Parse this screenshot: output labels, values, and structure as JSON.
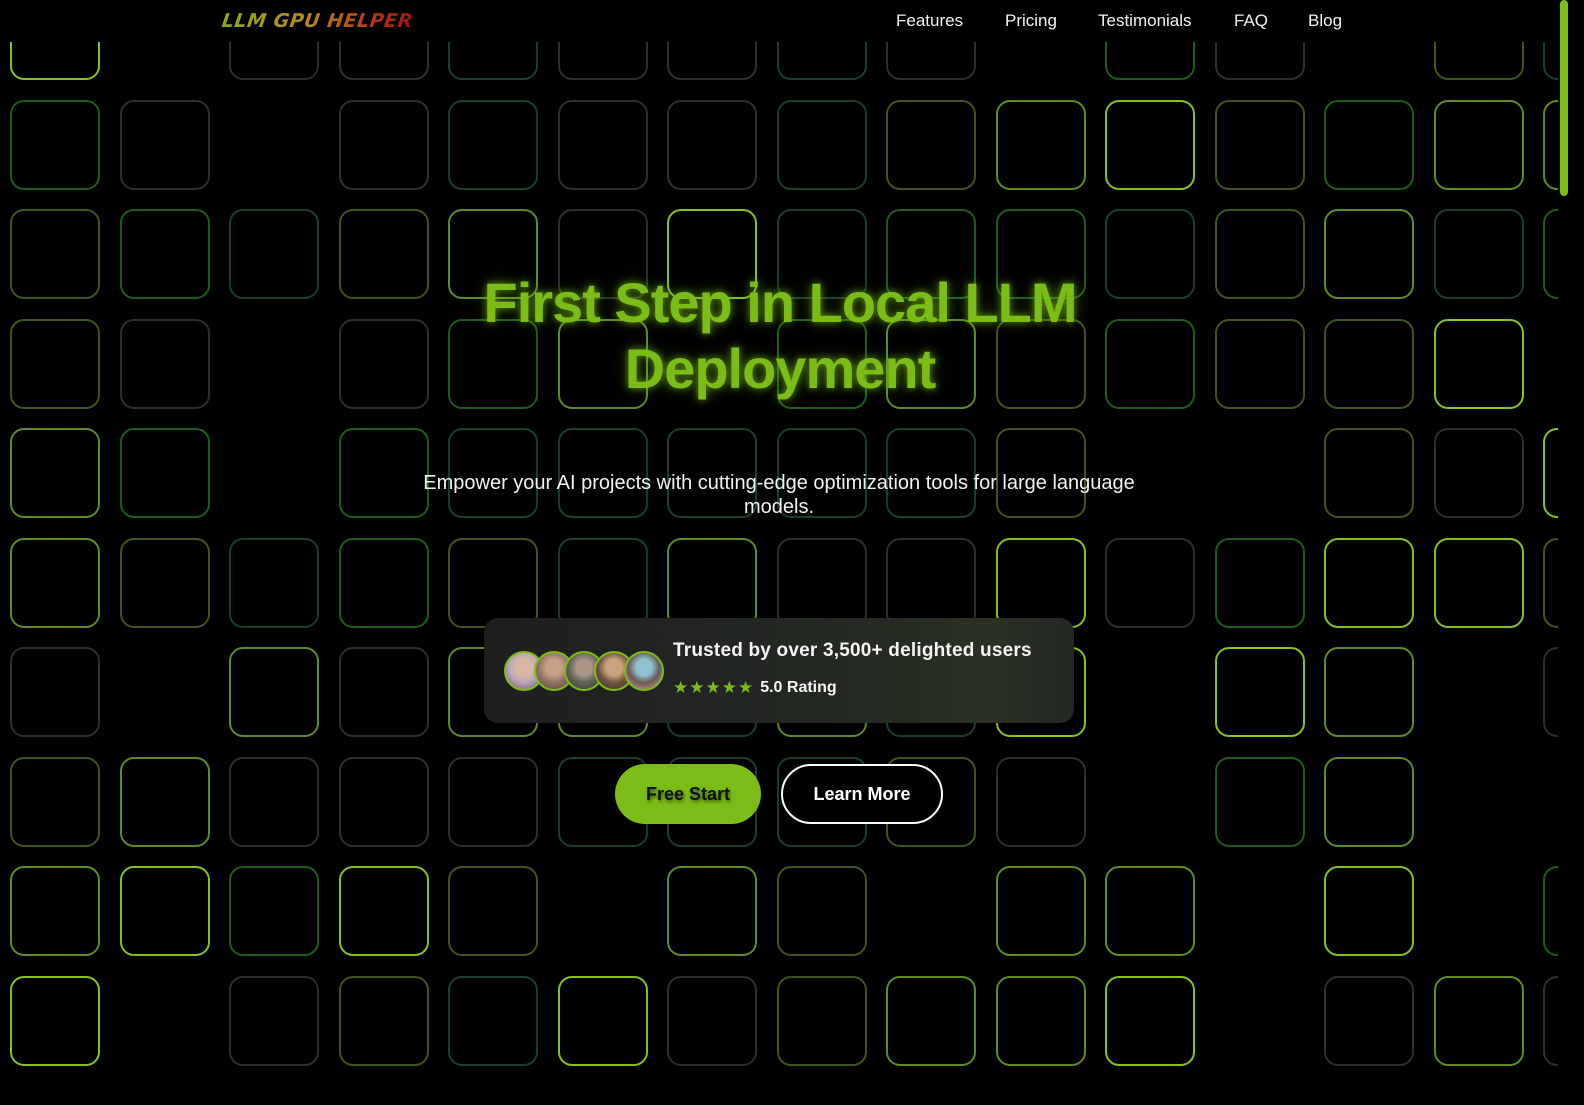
{
  "brand": {
    "logo_text": "LLM GPU HELPER"
  },
  "nav": {
    "items": [
      {
        "label": "Features"
      },
      {
        "label": "Pricing"
      },
      {
        "label": "Testimonials"
      },
      {
        "label": "FAQ"
      },
      {
        "label": "Blog"
      }
    ]
  },
  "hero": {
    "title_line1": "First Step in Local LLM",
    "title_line2": "Deployment",
    "subtitle": "Empower your AI projects with cutting-edge optimization tools for large language models."
  },
  "trust": {
    "headline": "Trusted by over 3,500+ delighted users",
    "stars": "★★★★★",
    "star_count": 5,
    "rating_label": "5.0 Rating",
    "avatars": [
      {
        "name": "user-avatar-1",
        "colors": [
          "#b7a6b8",
          "#d9b7a6",
          "#6d4f63"
        ]
      },
      {
        "name": "user-avatar-2",
        "colors": [
          "#8e7364",
          "#c79f86",
          "#5b4235"
        ]
      },
      {
        "name": "user-avatar-3",
        "colors": [
          "#5e6353",
          "#a89484",
          "#3a3c34"
        ]
      },
      {
        "name": "user-avatar-4",
        "colors": [
          "#6d5440",
          "#c9a47a",
          "#3b2d22"
        ]
      },
      {
        "name": "user-avatar-5",
        "colors": [
          "#6b5a55",
          "#8fc3d2",
          "#e79ca7"
        ]
      }
    ]
  },
  "actions": {
    "primary_label": "Free Start",
    "secondary_label": "Learn More"
  },
  "theme": {
    "accent": "#7cbc17",
    "background": "#000000",
    "tile_palette": {
      "g": "#2e2e2e",
      "d": "#1f5c1c",
      "t": "#1b3d31",
      "o": "#3f5619",
      "m": "#5f8c22",
      "b": "#84c21d"
    }
  },
  "background_tiles": {
    "rows": [
      "b0ggtggtg0dg0ot",
      "dg0gtggtombodmm",
      "odtomgbtddtomtd",
      "og0gdm0dmodoob0",
      "md0dttttto00ogb0",
      "motdotmggbgdbbo",
      "g0mgmmtmtb0bm0g",
      "omgggttto g0dm00",
      "mbdbo0mo0mm0b0d",
      "b0gotbgommb0gmg"
    ]
  }
}
